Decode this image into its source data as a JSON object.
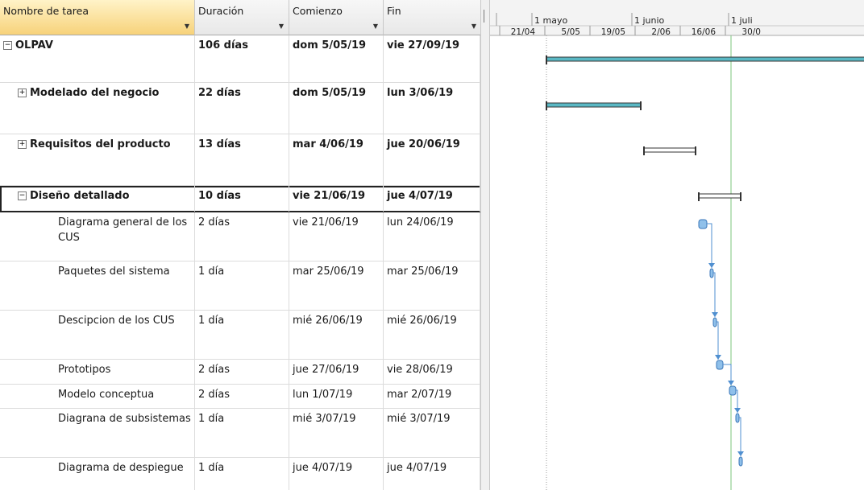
{
  "columns": {
    "name": "Nombre de tarea",
    "duration": "Duración",
    "start": "Comienzo",
    "finish": "Fin"
  },
  "timescale": {
    "months": [
      "1 mayo",
      "1 junio",
      "1 juli"
    ],
    "weeks": [
      "21/04",
      "5/05",
      "19/05",
      "2/06",
      "16/06",
      "30/0"
    ]
  },
  "tasks": [
    {
      "name": "OLPAV",
      "duration": "106 días",
      "start": "dom 5/05/19",
      "finish": "vie 27/09/19",
      "summary": true,
      "toggle": "−",
      "level": 0
    },
    {
      "name": "Modelado del negocio",
      "duration": "22 días",
      "start": "dom 5/05/19",
      "finish": "lun 3/06/19",
      "summary": true,
      "toggle": "+",
      "level": 1
    },
    {
      "name": "Requisitos del producto",
      "duration": "13 días",
      "start": "mar 4/06/19",
      "finish": "jue 20/06/19",
      "summary": true,
      "toggle": "+",
      "level": 1
    },
    {
      "name": "Diseño detallado",
      "duration": "10 días",
      "start": "vie 21/06/19",
      "finish": "jue 4/07/19",
      "summary": true,
      "toggle": "−",
      "level": 1
    },
    {
      "name": "Diagrama general de los CUS",
      "duration": "2 días",
      "start": "vie 21/06/19",
      "finish": "lun 24/06/19",
      "summary": false,
      "level": 2
    },
    {
      "name": "Paquetes del sistema",
      "duration": "1 día",
      "start": "mar 25/06/19",
      "finish": "mar 25/06/19",
      "summary": false,
      "level": 2
    },
    {
      "name": "Descipcion de los CUS",
      "duration": "1 día",
      "start": "mié 26/06/19",
      "finish": "mié 26/06/19",
      "summary": false,
      "level": 2
    },
    {
      "name": "Prototipos",
      "duration": "2 días",
      "start": "jue 27/06/19",
      "finish": "vie 28/06/19",
      "summary": false,
      "level": 2
    },
    {
      "name": "Modelo conceptua",
      "duration": "2 días",
      "start": "lun 1/07/19",
      "finish": "mar 2/07/19",
      "summary": false,
      "level": 2
    },
    {
      "name": "Diagrana de subsistemas",
      "duration": "1 día",
      "start": "mié 3/07/19",
      "finish": "mié 3/07/19",
      "summary": false,
      "level": 2
    },
    {
      "name": "Diagrama de despiegue",
      "duration": "1 día",
      "start": "jue 4/07/19",
      "finish": "jue 4/07/19",
      "summary": false,
      "level": 2
    }
  ],
  "colors": {
    "summary_bar": "#5ab8c4",
    "task_bar": "#8fc0ea",
    "link": "#4f8fd0",
    "today_line": "#7bc67b"
  }
}
